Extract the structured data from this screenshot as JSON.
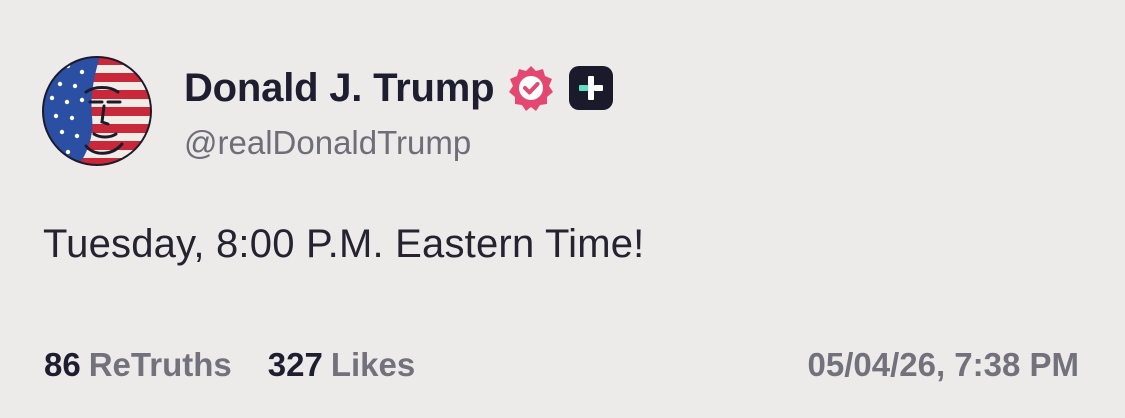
{
  "author": {
    "display_name": "Donald J. Trump",
    "handle": "@realDonaldTrump",
    "avatar_icon": "avatar-flag-portrait",
    "verified_icon": "verified-badge-icon",
    "verified_color": "#e44870",
    "plus_icon": "plus-badge-icon",
    "plus_color": "#1b1a2b",
    "plus_accent": "#5ee0c2"
  },
  "post": {
    "text": "Tuesday, 8:00 P.M. Eastern Time!"
  },
  "stats": {
    "retruths_count": "86",
    "retruths_label": "ReTruths",
    "likes_count": "327",
    "likes_label": "Likes"
  },
  "timestamp": "05/04/26, 7:38 PM",
  "colors": {
    "background": "#ecebea",
    "text": "#1f1e30",
    "muted": "#73727c"
  }
}
